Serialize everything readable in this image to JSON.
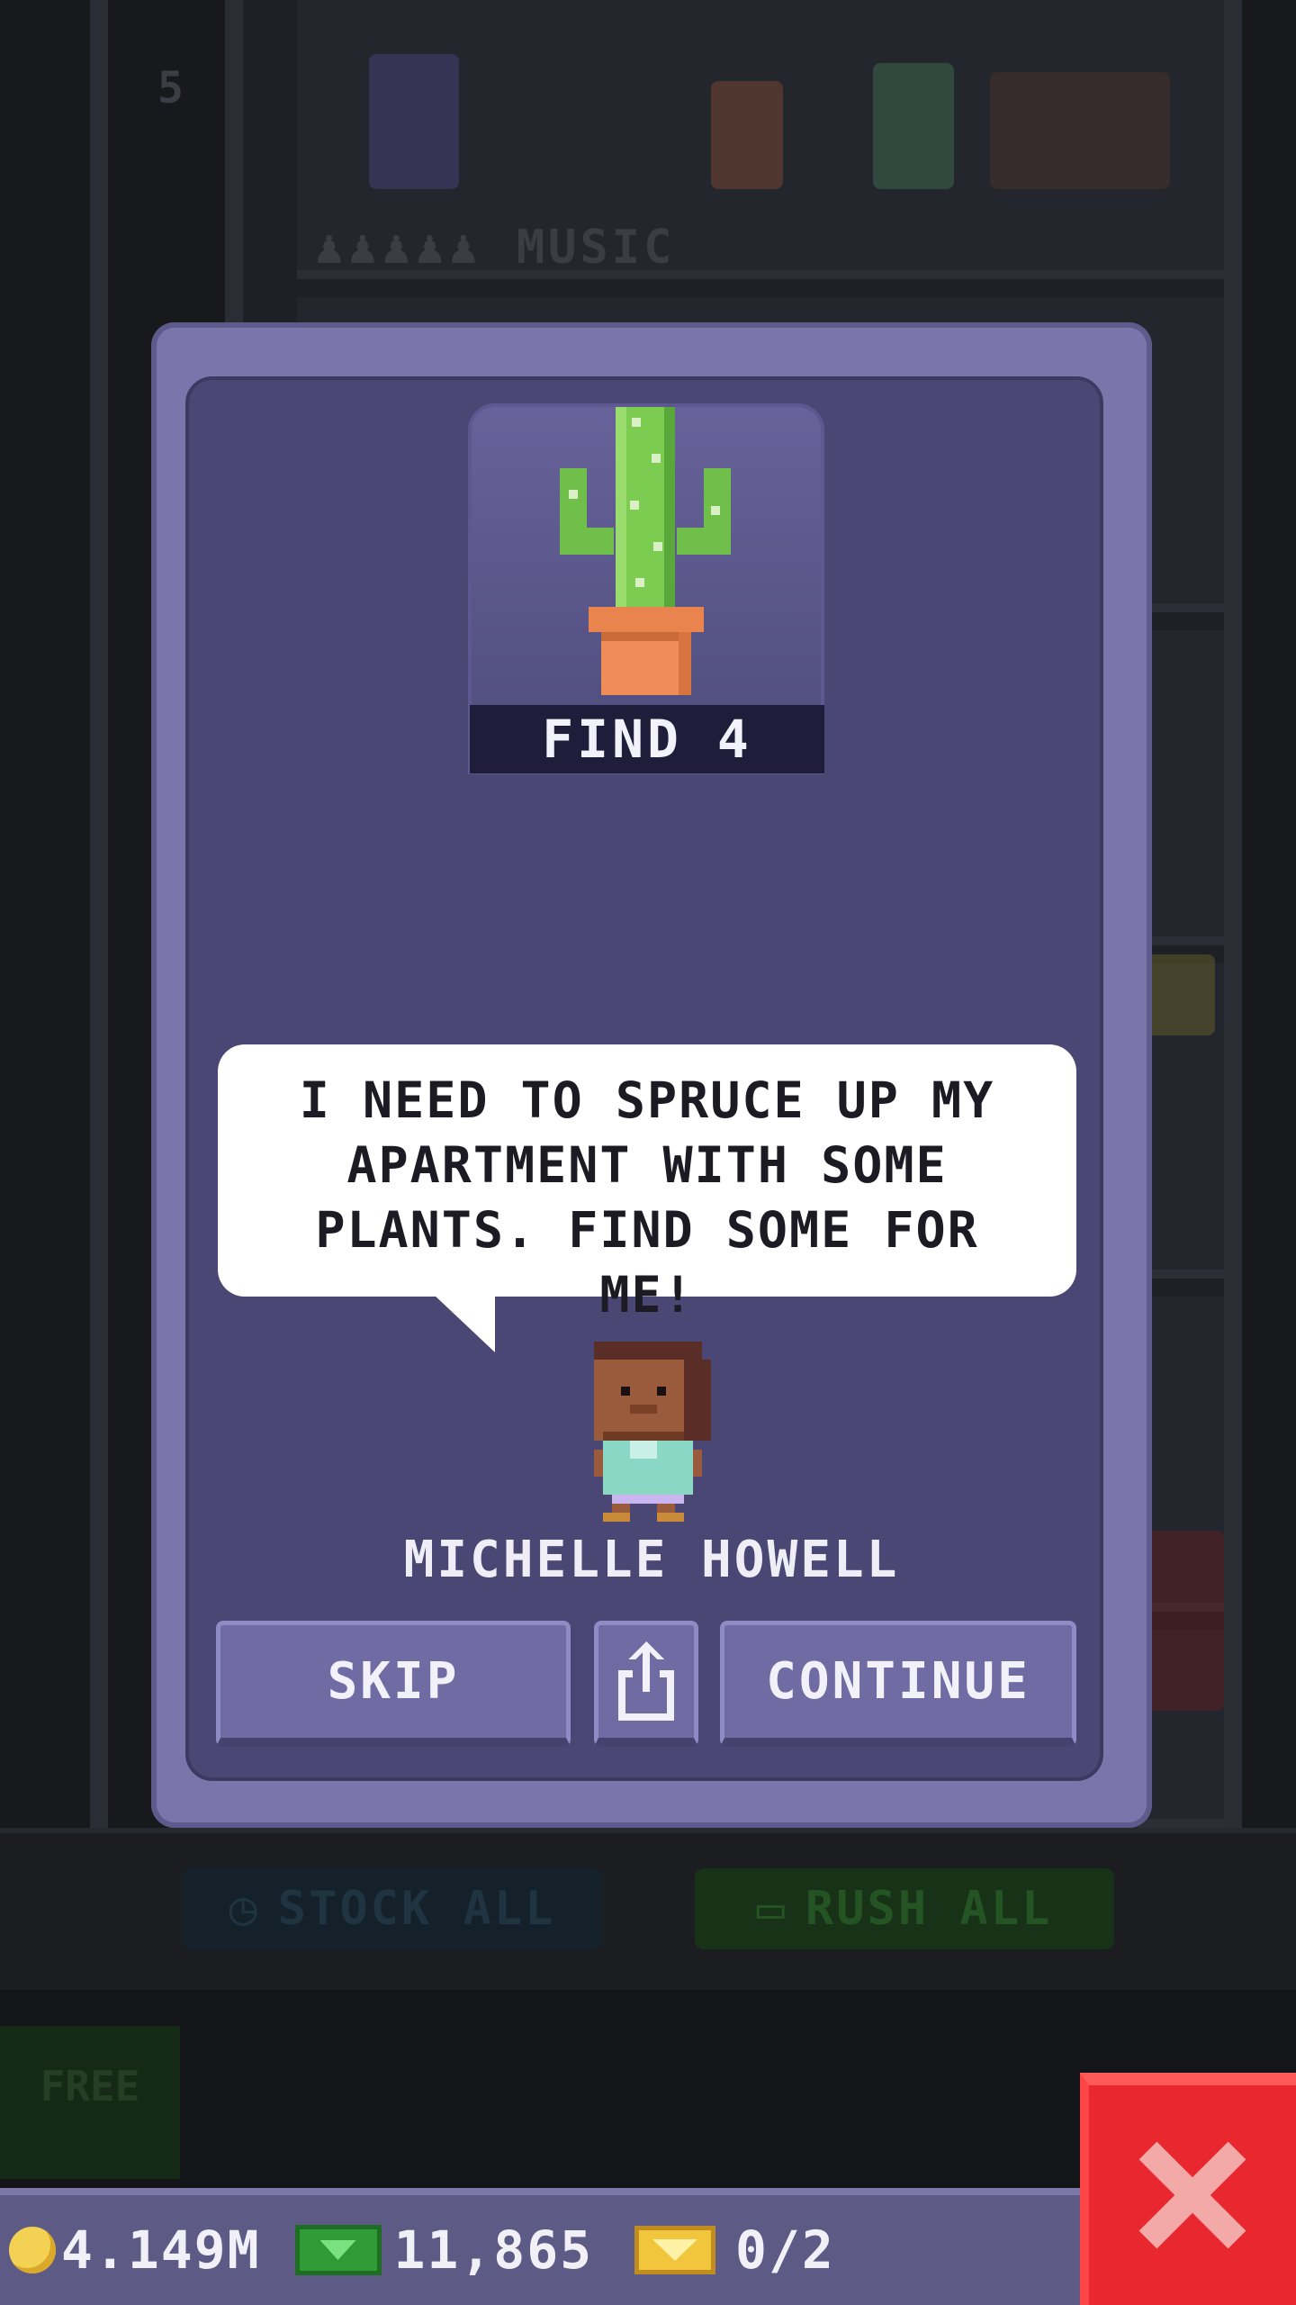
{
  "background": {
    "floor_label": "MUSIC",
    "floor_number": "5",
    "stock_all_label": "STOCK ALL",
    "rush_all_label": "RUSH ALL",
    "free_label": "FREE"
  },
  "mission": {
    "goal_item_icon": "cactus-in-pot",
    "goal_caption": "FIND 4",
    "speech": "I NEED TO SPRUCE UP MY APARTMENT WITH SOME PLANTS. FIND SOME FOR ME!",
    "npc_name": "MICHELLE HOWELL",
    "skip_label": "SKIP",
    "share_icon": "share-icon",
    "continue_label": "CONTINUE"
  },
  "status_bar": {
    "coins": "4.149M",
    "bux": "11,865",
    "tickets": "0/2"
  },
  "colors": {
    "modal": "#7a76ac",
    "modal_inner": "#4a4775",
    "close_button": "#e8282e"
  }
}
